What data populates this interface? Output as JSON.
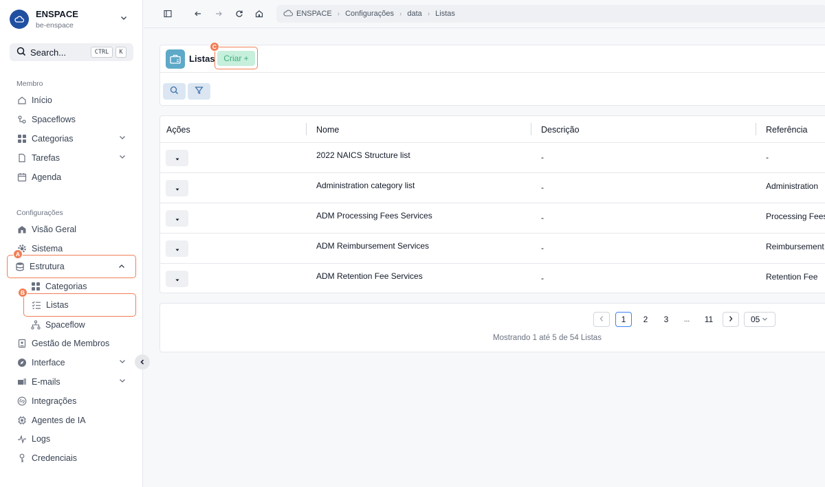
{
  "workspace": {
    "name": "ENSPACE",
    "subtitle": "be-enspace"
  },
  "search": {
    "label": "Search...",
    "shortcut_1": "CTRL",
    "shortcut_2": "K"
  },
  "sidebar": {
    "section_member": "Membro",
    "section_settings": "Configurações",
    "member_items": [
      {
        "label": "Início",
        "icon": "home-icon"
      },
      {
        "label": "Spaceflows",
        "icon": "spaceflow-icon"
      },
      {
        "label": "Categorias",
        "icon": "grid-icon"
      },
      {
        "label": "Tarefas",
        "icon": "file-icon"
      },
      {
        "label": "Agenda",
        "icon": "calendar-icon"
      }
    ],
    "settings_items": [
      {
        "label": "Visão Geral",
        "icon": "building-icon"
      },
      {
        "label": "Sistema",
        "icon": "gear-icon"
      },
      {
        "label": "Estrutura",
        "icon": "database-icon"
      },
      {
        "label": "Categorias",
        "icon": "grid-icon"
      },
      {
        "label": "Listas",
        "icon": "list-icon"
      },
      {
        "label": "Spaceflow",
        "icon": "flow-icon"
      },
      {
        "label": "Gestão de Membros",
        "icon": "id-card-icon"
      },
      {
        "label": "Interface",
        "icon": "compass-icon"
      },
      {
        "label": "E-mails",
        "icon": "mail-icon"
      },
      {
        "label": "Integrações",
        "icon": "link-icon"
      },
      {
        "label": "Agentes de IA",
        "icon": "chip-icon"
      },
      {
        "label": "Logs",
        "icon": "pulse-icon"
      },
      {
        "label": "Credenciais",
        "icon": "key-icon"
      }
    ]
  },
  "annotations": {
    "a": "A",
    "b": "B",
    "c": "C"
  },
  "breadcrumb": [
    "ENSPACE",
    "Configurações",
    "data",
    "Listas"
  ],
  "page": {
    "title": "Listas",
    "create_label": "Criar +"
  },
  "table": {
    "headers": [
      "Ações",
      "Nome",
      "Descrição",
      "Referência"
    ],
    "rows": [
      {
        "name": "2022 NAICS Structure list",
        "description": "-",
        "reference": "-"
      },
      {
        "name": "Administration category list",
        "description": "-",
        "reference": "Administration"
      },
      {
        "name": "ADM Processing Fees Services",
        "description": "-",
        "reference": "Processing Fees"
      },
      {
        "name": "ADM Reimbursement Services",
        "description": "-",
        "reference": "Reimbursement"
      },
      {
        "name": "ADM Retention Fee Services",
        "description": "-",
        "reference": "Retention Fee"
      }
    ]
  },
  "pagination": {
    "pages": [
      "1",
      "2",
      "3",
      "...",
      "11"
    ],
    "current": "1",
    "page_size": "05",
    "info": "Mostrando 1 até 5 de 54 Listas"
  },
  "colors": {
    "accent": "#f07e56",
    "create_bg": "#c6efdc",
    "create_text": "#3fae7a",
    "list_icon": "#5ea8c8",
    "brand": "#1f4fa0"
  }
}
